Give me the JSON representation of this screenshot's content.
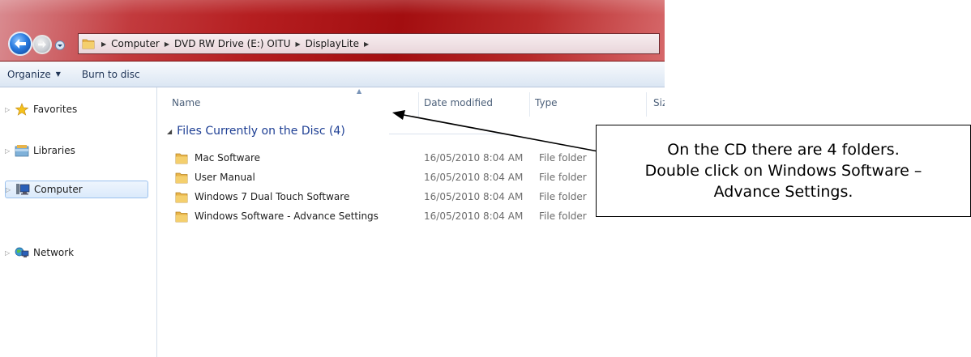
{
  "breadcrumb": [
    "Computer",
    "DVD RW Drive (E:) OITU",
    "DisplayLite"
  ],
  "toolbar": {
    "organize_label": "Organize",
    "burn_label": "Burn to disc"
  },
  "nav": {
    "items": [
      "Favorites",
      "Libraries",
      "Computer",
      "Network"
    ],
    "selected": "Computer"
  },
  "columns": {
    "name": "Name",
    "date": "Date modified",
    "type": "Type",
    "size": "Size",
    "sorted_by": "Name"
  },
  "group": {
    "header": "Files Currently on the Disc (4)"
  },
  "files": [
    {
      "name": "Mac Software",
      "date": "16/05/2010 8:04 AM",
      "type": "File folder"
    },
    {
      "name": "User Manual",
      "date": "16/05/2010 8:04 AM",
      "type": "File folder"
    },
    {
      "name": "Windows 7 Dual Touch Software",
      "date": "16/05/2010 8:04 AM",
      "type": "File folder"
    },
    {
      "name": "Windows Software - Advance Settings",
      "date": "16/05/2010 8:04 AM",
      "type": "File folder"
    }
  ],
  "callout": {
    "lines": [
      "On the CD there are 4 folders.",
      "Double click on Windows Software –",
      "Advance Settings."
    ]
  },
  "colors": {
    "title_bar": "#b51e20",
    "group_header": "#1e3f94",
    "folder": "#e8b44a"
  },
  "icons": [
    "back-arrow-icon",
    "forward-arrow-icon",
    "folder-icon",
    "star-icon",
    "library-icon",
    "computer-icon",
    "network-icon"
  ]
}
